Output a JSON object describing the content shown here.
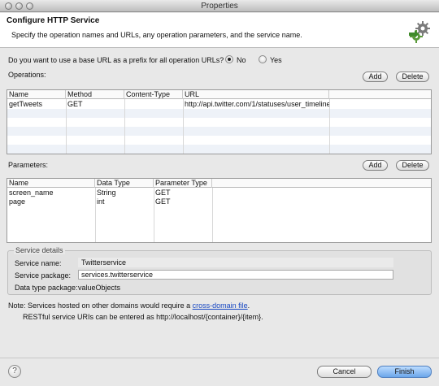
{
  "window": {
    "title": "Properties"
  },
  "header": {
    "title": "Configure HTTP Service",
    "description": "Specify the operation names and URLs, any operation parameters, and the service name."
  },
  "base_url": {
    "question": "Do you want to use a base URL as a prefix for all operation URLs?",
    "options": [
      {
        "label": "No",
        "selected": true
      },
      {
        "label": "Yes",
        "selected": false
      }
    ]
  },
  "operations": {
    "label": "Operations:",
    "add_label": "Add",
    "delete_label": "Delete",
    "columns": [
      "Name",
      "Method",
      "Content-Type",
      "URL"
    ],
    "rows": [
      [
        "getTweets",
        "GET",
        "",
        "http://api.twitter.com/1/statuses/user_timeline"
      ]
    ]
  },
  "parameters": {
    "label": "Parameters:",
    "add_label": "Add",
    "delete_label": "Delete",
    "columns": [
      "Name",
      "Data Type",
      "Parameter Type"
    ],
    "rows": [
      [
        "screen_name",
        "String",
        "GET"
      ],
      [
        "page",
        "int",
        "GET"
      ]
    ]
  },
  "service_details": {
    "title": "Service details",
    "name_label": "Service name:",
    "name_value": "Twitterservice",
    "package_label": "Service package:",
    "package_value": "services.twitterservice",
    "datatype_label": "Data type package:",
    "datatype_value": "valueObjects"
  },
  "note": {
    "prefix": "Note: Services hosted on other domains would require a ",
    "link": "cross-domain file",
    "suffix": ".",
    "line2": "RESTful service URIs can be entered as http://localhost/{container}/{item}."
  },
  "footer": {
    "help": "?",
    "cancel_label": "Cancel",
    "finish_label": "Finish"
  },
  "colors": {
    "primary_button": "#6ba6ea",
    "link": "#1646c2",
    "row_alt": "#eef2f8"
  }
}
